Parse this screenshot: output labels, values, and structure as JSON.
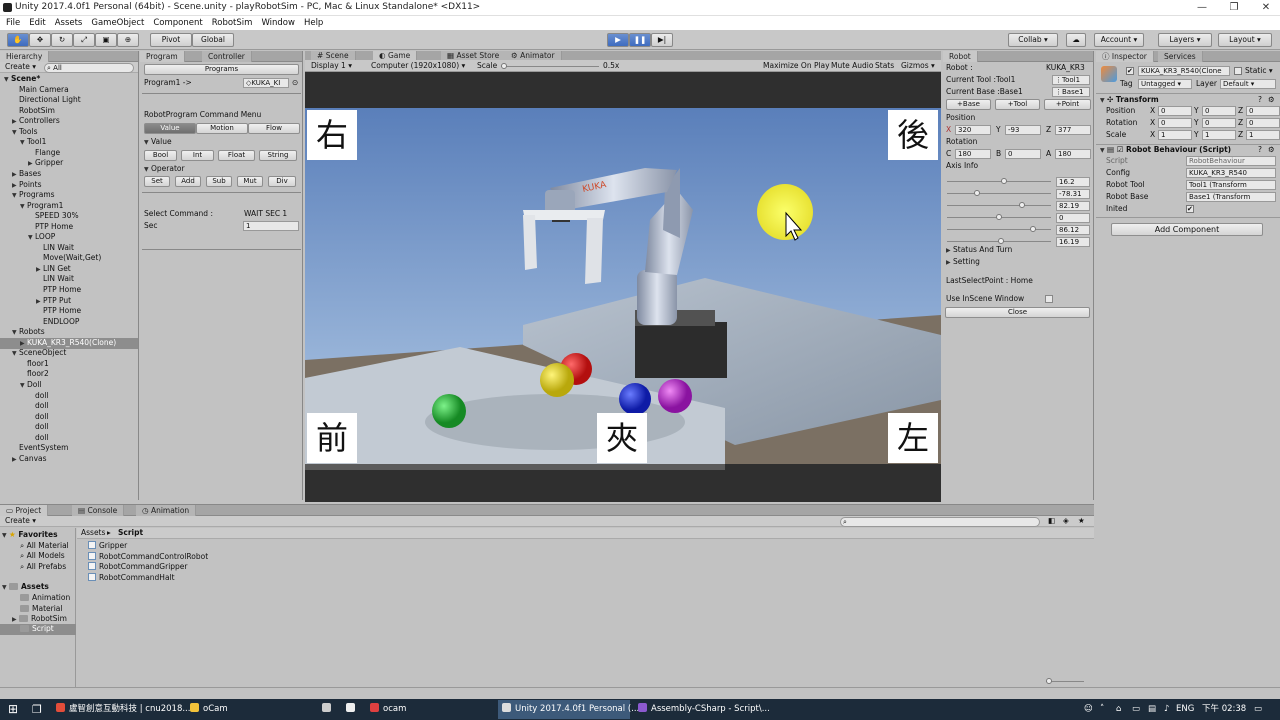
{
  "window": {
    "title": "Unity 2017.4.0f1 Personal (64bit) - Scene.unity - playRobotSim - PC, Mac & Linux Standalone* <DX11>",
    "minimize": "—",
    "restore": "❐",
    "close": "✕"
  },
  "menu": [
    "File",
    "Edit",
    "Assets",
    "GameObject",
    "Component",
    "RobotSim",
    "Window",
    "Help"
  ],
  "toolbar": {
    "pivot": "Pivot",
    "global": "Global",
    "collab": "Collab ▾",
    "account": "Account",
    "layers": "Layers",
    "layout": "Layout"
  },
  "hierarchy": {
    "tab": "Hierarchy",
    "create": "Create ▾",
    "search": "All",
    "items": [
      {
        "label": "Scene*",
        "depth": 0,
        "arrow": "▼",
        "bold": true
      },
      {
        "label": "Main Camera",
        "depth": 1,
        "arrow": ""
      },
      {
        "label": "Directional Light",
        "depth": 1,
        "arrow": ""
      },
      {
        "label": "RobotSim",
        "depth": 1,
        "arrow": ""
      },
      {
        "label": "Controllers",
        "depth": 1,
        "arrow": "▶"
      },
      {
        "label": "Tools",
        "depth": 1,
        "arrow": "▼"
      },
      {
        "label": "Tool1",
        "depth": 2,
        "arrow": "▼"
      },
      {
        "label": "Flange",
        "depth": 3,
        "arrow": ""
      },
      {
        "label": "Gripper",
        "depth": 3,
        "arrow": "▶"
      },
      {
        "label": "Bases",
        "depth": 1,
        "arrow": "▶"
      },
      {
        "label": "Points",
        "depth": 1,
        "arrow": "▶"
      },
      {
        "label": "Programs",
        "depth": 1,
        "arrow": "▼"
      },
      {
        "label": "Program1",
        "depth": 2,
        "arrow": "▼"
      },
      {
        "label": "SPEED 30%",
        "depth": 3,
        "arrow": ""
      },
      {
        "label": "PTP Home",
        "depth": 3,
        "arrow": ""
      },
      {
        "label": "LOOP",
        "depth": 3,
        "arrow": "▼"
      },
      {
        "label": "LIN Wait",
        "depth": 4,
        "arrow": ""
      },
      {
        "label": "Move(Wait,Get)",
        "depth": 4,
        "arrow": ""
      },
      {
        "label": "LIN Get",
        "depth": 4,
        "arrow": "▶"
      },
      {
        "label": "LIN Wait",
        "depth": 4,
        "arrow": ""
      },
      {
        "label": "PTP Home",
        "depth": 4,
        "arrow": ""
      },
      {
        "label": "PTP Put",
        "depth": 4,
        "arrow": "▶"
      },
      {
        "label": "PTP Home",
        "depth": 4,
        "arrow": ""
      },
      {
        "label": "ENDLOOP",
        "depth": 4,
        "arrow": ""
      },
      {
        "label": "Robots",
        "depth": 1,
        "arrow": "▼"
      },
      {
        "label": "KUKA_KR3_R540(Clone)",
        "depth": 2,
        "arrow": "▶",
        "selected": true
      },
      {
        "label": "SceneObject",
        "depth": 1,
        "arrow": "▼"
      },
      {
        "label": "floor1",
        "depth": 2,
        "arrow": ""
      },
      {
        "label": "floor2",
        "depth": 2,
        "arrow": ""
      },
      {
        "label": "Doll",
        "depth": 2,
        "arrow": "▼"
      },
      {
        "label": "doll",
        "depth": 3,
        "arrow": ""
      },
      {
        "label": "doll",
        "depth": 3,
        "arrow": ""
      },
      {
        "label": "doll",
        "depth": 3,
        "arrow": ""
      },
      {
        "label": "doll",
        "depth": 3,
        "arrow": ""
      },
      {
        "label": "doll",
        "depth": 3,
        "arrow": ""
      },
      {
        "label": "EventSystem",
        "depth": 1,
        "arrow": ""
      },
      {
        "label": "Canvas",
        "depth": 1,
        "arrow": "▶"
      }
    ]
  },
  "program": {
    "tabs": [
      "Program",
      "Controller"
    ],
    "programs_btn": "Programs",
    "program_label": "Program1 ->",
    "program_obj": "KUKA_KI",
    "menu_title": "RobotProgram Command Menu",
    "modes": [
      "Value",
      "Motion",
      "Flow"
    ],
    "value_head": "Value",
    "value_btns": [
      "Bool",
      "Int",
      "Float",
      "String"
    ],
    "operator_head": "Operator",
    "operator_btns": [
      "Set",
      "Add",
      "Sub",
      "Mut",
      "Div"
    ],
    "select_label": "Select Command :",
    "select_value": "WAIT SEC 1",
    "sec_label": "Sec",
    "sec_value": "1"
  },
  "game": {
    "tabs": [
      "Scene",
      "Game",
      "Asset Store",
      "Animator"
    ],
    "display": "Display 1",
    "resolution": "Computer (1920x1080)",
    "scale_label": "Scale",
    "scale_value": "0.5x",
    "options": [
      "Maximize On Play",
      "Mute Audio",
      "Stats",
      "Gizmos"
    ],
    "robot_brand": "KUKA",
    "labels": {
      "right": "右",
      "back": "後",
      "front": "前",
      "grip": "夾",
      "left": "左"
    }
  },
  "robot": {
    "tab": "Robot",
    "robot_label": "Robot :",
    "robot_value": "KUKA_KR3",
    "tool_label": "Current Tool :Tool1",
    "tool_value": "Tool1",
    "base_label": "Current Base :Base1",
    "base_value": "Base1",
    "add_btns": [
      "+Base",
      "+Tool",
      "+Point"
    ],
    "position_label": "Position",
    "pos": {
      "x": "320",
      "y": "-93",
      "z": "377"
    },
    "rotation_label": "Rotation",
    "rot": {
      "c": "180",
      "b": "0",
      "a": "180"
    },
    "axis_label": "Axis Info",
    "axes": [
      {
        "value": "16.2",
        "fill": 0.55
      },
      {
        "value": "-78.31",
        "fill": 0.28
      },
      {
        "value": "82.19",
        "fill": 0.73
      },
      {
        "value": "0",
        "fill": 0.5
      },
      {
        "value": "86.12",
        "fill": 0.85
      },
      {
        "value": "16.19",
        "fill": 0.52
      }
    ],
    "status_turn": "Status And Turn",
    "setting": "Setting",
    "last_point": "LastSelectPoint : Home",
    "use_window": "Use InScene Window",
    "close_btn": "Close"
  },
  "inspector": {
    "tabs": [
      "Inspector",
      "Services"
    ],
    "object_name": "KUKA_KR3_R540(Clone",
    "static_label": "Static",
    "tag_label": "Tag",
    "tag_value": "Untagged",
    "layer_label": "Layer",
    "layer_value": "Default",
    "transform_title": "Transform",
    "transform": [
      {
        "label": "Position",
        "x": "0",
        "y": "0",
        "z": "0"
      },
      {
        "label": "Rotation",
        "x": "0",
        "y": "0",
        "z": "0"
      },
      {
        "label": "Scale",
        "x": "1",
        "y": "1",
        "z": "1"
      }
    ],
    "script_title": "Robot Behaviour (Script)",
    "script_label": "Script",
    "script_value": "RobotBehaviour",
    "config_label": "Config",
    "config_value": "KUKA_KR3_R540",
    "tool_label": "Robot Tool",
    "tool_value": "Tool1 (Transform",
    "base_label": "Robot Base",
    "base_value": "Base1 (Transform",
    "inited_label": "Inited",
    "add_component": "Add Component"
  },
  "project": {
    "tabs": [
      "Project",
      "Console",
      "Animation"
    ],
    "create": "Create ▾",
    "favorites_title": "Favorites",
    "favorites": [
      "All Material",
      "All Models",
      "All Prefabs"
    ],
    "assets_title": "Assets",
    "assets": [
      "Animation",
      "Material",
      "RobotSim",
      "Script"
    ],
    "breadcrumb_root": "Assets",
    "breadcrumb_sep": "▸",
    "breadcrumb_current": "Script",
    "files": [
      "Gripper",
      "RobotCommandControlRobot",
      "RobotCommandGripper",
      "RobotCommandHalt"
    ]
  },
  "taskbar": {
    "tasks": [
      "盧智創意互動科技 | cnu2018...",
      "oCam",
      "ocam",
      "Unity 2017.4.0f1 Personal (...",
      "Assembly-CSharp - Script\\..."
    ],
    "lang": "ENG",
    "time": "下午 02:38"
  },
  "colors": {
    "selection": "#5b82c9",
    "play_active": "#3e6cc0",
    "taskbar": "#1c2b3a"
  }
}
